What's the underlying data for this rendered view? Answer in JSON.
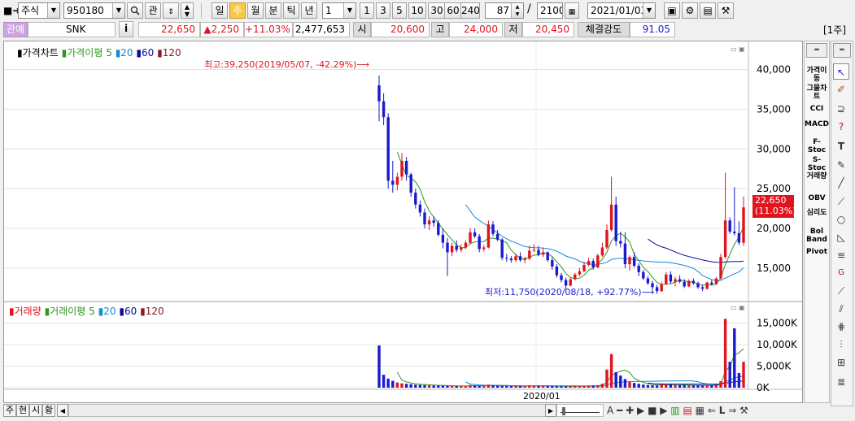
{
  "toolbar": {
    "market": "주식",
    "code": "950180",
    "relation_btn": "관",
    "periods": [
      "일",
      "주",
      "월",
      "분",
      "틱",
      "년"
    ],
    "selected_period": "주",
    "unit_value": "1",
    "quick_units": [
      "1",
      "3",
      "5",
      "10",
      "30",
      "60",
      "240"
    ],
    "display_count": "87",
    "total_count": "2100",
    "date": "2021/01/03"
  },
  "info": {
    "tag": "관예",
    "name": "SNK",
    "info_btn": "i",
    "price": "22,650",
    "change": "▲2,250",
    "change_pct": "+11.03%",
    "volume": "2,477,653",
    "open_label": "시",
    "open": "20,600",
    "high_label": "고",
    "high": "24,000",
    "low_label": "저",
    "low": "20,450",
    "strength_label": "체결강도",
    "strength": "91.05",
    "period_badge": "[1주]"
  },
  "price_panel": {
    "legend": {
      "title": "가격차트",
      "ma_label": "가격이평",
      "ma5": "5",
      "ma20": "20",
      "ma60": "60",
      "ma120": "120"
    },
    "max_annotation": "최고:39,250(2019/05/07, -42.29%)⟶",
    "min_annotation": "최저:11,750(2020/08/18, +92.77%)⟶",
    "current_price_label": "22,650",
    "current_pct_label": "(11.03%)",
    "y_ticks": [
      "40,000",
      "35,000",
      "30,000",
      "25,000",
      "20,000",
      "15,000"
    ]
  },
  "volume_panel": {
    "legend": {
      "title": "거래량",
      "ma_label": "거래이평",
      "ma5": "5",
      "ma20": "20",
      "ma60": "60",
      "ma120": "120"
    },
    "y_ticks": [
      "15,000K",
      "10,000K",
      "5,000K",
      "0K"
    ]
  },
  "x_axis": {
    "label": "2020/01"
  },
  "indicators": [
    "가격이동",
    "그물차트",
    "CCI",
    "MACD",
    "F-Stoc",
    "S-Stoc",
    "거래량",
    "OBV",
    "심리도",
    "Bol Band",
    "Pivot"
  ],
  "bottom_tabs": [
    "주",
    "현",
    "시",
    "황"
  ],
  "colors": {
    "up": "#e0141e",
    "down": "#1a1ad0",
    "ma5": "#2a9a18",
    "ma20": "#1488d8",
    "ma60": "#0a0a9a",
    "ma120": "#8a1a2a",
    "selected": "#f7c948"
  },
  "chart_data": {
    "type": "candlestick",
    "period": "weekly",
    "first_week": "2019/05/07",
    "price_ylim": [
      11000,
      42000
    ],
    "volume_ylim": [
      0,
      17000000
    ],
    "ohlc": [
      [
        38000,
        39250,
        33500,
        36000
      ],
      [
        36000,
        37000,
        33000,
        34000
      ],
      [
        34000,
        34500,
        25000,
        26000
      ],
      [
        26000,
        28500,
        24500,
        25500
      ],
      [
        25500,
        27000,
        24800,
        26500
      ],
      [
        26500,
        29500,
        26000,
        28500
      ],
      [
        28500,
        29000,
        26000,
        26800
      ],
      [
        26800,
        27000,
        24000,
        24500
      ],
      [
        24500,
        25000,
        22500,
        23000
      ],
      [
        23000,
        23500,
        21500,
        22000
      ],
      [
        22000,
        22500,
        20000,
        20500
      ],
      [
        20500,
        21500,
        19800,
        21000
      ],
      [
        21000,
        21500,
        20200,
        20700
      ],
      [
        20700,
        21000,
        19000,
        19200
      ],
      [
        19200,
        20000,
        17500,
        18200
      ],
      [
        18200,
        18800,
        14000,
        17000
      ],
      [
        17000,
        18200,
        16500,
        17800
      ],
      [
        17800,
        18500,
        17000,
        17300
      ],
      [
        17300,
        18000,
        17000,
        17600
      ],
      [
        17600,
        18500,
        17400,
        18200
      ],
      [
        18200,
        20000,
        18000,
        19500
      ],
      [
        19500,
        20000,
        18800,
        19000
      ],
      [
        19000,
        19300,
        17000,
        17400
      ],
      [
        17400,
        17900,
        17100,
        17600
      ],
      [
        17600,
        21000,
        17500,
        20500
      ],
      [
        20500,
        20900,
        19000,
        19300
      ],
      [
        19300,
        19800,
        18400,
        18600
      ],
      [
        18600,
        18800,
        16000,
        16300
      ],
      [
        16300,
        16800,
        15800,
        16200
      ],
      [
        16200,
        16500,
        15700,
        16000
      ],
      [
        16000,
        16800,
        15800,
        16500
      ],
      [
        16500,
        17000,
        15800,
        16000
      ],
      [
        16000,
        16400,
        15600,
        16200
      ],
      [
        16200,
        17800,
        16000,
        17200
      ],
      [
        17200,
        18000,
        17000,
        17300
      ],
      [
        17300,
        17800,
        16500,
        16700
      ],
      [
        16700,
        17600,
        16400,
        17000
      ],
      [
        17000,
        17100,
        15800,
        16000
      ],
      [
        16000,
        16300,
        14800,
        15200
      ],
      [
        15200,
        15500,
        13800,
        14100
      ],
      [
        14100,
        14400,
        13200,
        13500
      ],
      [
        13500,
        13800,
        12300,
        12800
      ],
      [
        12800,
        13800,
        12700,
        13600
      ],
      [
        13600,
        14400,
        13500,
        14200
      ],
      [
        14200,
        15000,
        14000,
        14600
      ],
      [
        14600,
        15800,
        14500,
        15400
      ],
      [
        15400,
        16300,
        15200,
        15900
      ],
      [
        15900,
        16200,
        14800,
        15100
      ],
      [
        15100,
        16800,
        15000,
        16600
      ],
      [
        16600,
        18200,
        16400,
        17600
      ],
      [
        17600,
        20500,
        17400,
        19800
      ],
      [
        19800,
        26500,
        19600,
        23000
      ],
      [
        23000,
        24000,
        17800,
        18400
      ],
      [
        18400,
        19600,
        17600,
        18100
      ],
      [
        18100,
        19500,
        15000,
        15500
      ],
      [
        15500,
        16600,
        14700,
        16400
      ],
      [
        16400,
        17000,
        15100,
        15300
      ],
      [
        15300,
        15600,
        14000,
        14500
      ],
      [
        14500,
        14800,
        13500,
        13700
      ],
      [
        13700,
        14000,
        12900,
        13100
      ],
      [
        13100,
        13400,
        12200,
        12600
      ],
      [
        12600,
        12900,
        11750,
        12100
      ],
      [
        12100,
        13300,
        12000,
        13000
      ],
      [
        13000,
        14500,
        12900,
        14200
      ],
      [
        14200,
        14600,
        13000,
        13300
      ],
      [
        13300,
        13900,
        12700,
        13600
      ],
      [
        13600,
        14100,
        13100,
        13300
      ],
      [
        13300,
        13600,
        12500,
        12700
      ],
      [
        12700,
        13600,
        12600,
        13400
      ],
      [
        13400,
        13700,
        12900,
        13100
      ],
      [
        13100,
        13300,
        12400,
        12600
      ],
      [
        12600,
        12900,
        12100,
        12400
      ],
      [
        12400,
        13300,
        12300,
        13200
      ],
      [
        13200,
        13500,
        12800,
        13000
      ],
      [
        13000,
        13900,
        12900,
        13700
      ],
      [
        13700,
        16800,
        13600,
        16400
      ],
      [
        16400,
        27000,
        16200,
        21000
      ],
      [
        21000,
        21400,
        19300,
        19600
      ],
      [
        19600,
        25200,
        19100,
        19400
      ],
      [
        19400,
        20900,
        17900,
        18200
      ],
      [
        18200,
        24000,
        17800,
        22650
      ]
    ],
    "volume_k": [
      9800,
      3000,
      2100,
      1600,
      1200,
      1000,
      900,
      800,
      700,
      650,
      600,
      550,
      500,
      480,
      450,
      420,
      400,
      380,
      380,
      360,
      600,
      500,
      420,
      400,
      700,
      550,
      480,
      420,
      400,
      380,
      400,
      380,
      360,
      500,
      450,
      420,
      400,
      380,
      360,
      350,
      340,
      330,
      340,
      360,
      380,
      420,
      500,
      480,
      560,
      900,
      4200,
      7800,
      3600,
      2800,
      2000,
      1400,
      1100,
      900,
      700,
      600,
      550,
      520,
      800,
      900,
      700,
      600,
      580,
      560,
      540,
      520,
      500,
      480,
      520,
      500,
      700,
      1500,
      16000,
      6000,
      13800,
      3400,
      6000
    ]
  }
}
